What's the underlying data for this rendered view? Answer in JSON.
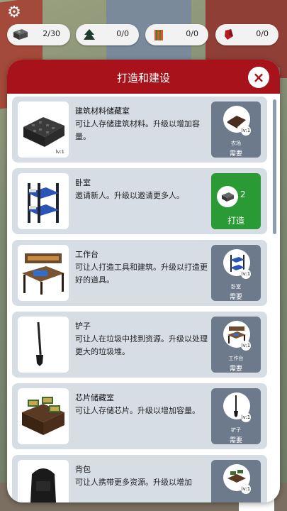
{
  "hud": {
    "resources": [
      {
        "icon": "brick-icon",
        "value": "2/30"
      },
      {
        "icon": "chip-icon",
        "value": "0/0"
      },
      {
        "icon": "book-icon",
        "value": "0/0"
      },
      {
        "icon": "crystal-icon",
        "value": "0/0"
      }
    ]
  },
  "panel": {
    "title": "打造和建设",
    "close_label": "×"
  },
  "items": [
    {
      "title": "建筑材料储藏室",
      "desc": "可让人存储建筑材料。升级以增加容量。",
      "level": "lv:1",
      "action": {
        "type": "requirement",
        "req_name": "农场",
        "req_level": "lv:1",
        "need_label": "需要"
      }
    },
    {
      "title": "卧室",
      "desc": "邀请新人。升级以邀请更多人。",
      "level": "",
      "action": {
        "type": "build",
        "cost": "2",
        "build_label": "打造"
      }
    },
    {
      "title": "工作台",
      "desc": "可让人打造工具和建筑。升级以打造更好的道具。",
      "level": "",
      "action": {
        "type": "requirement",
        "req_name": "卧室",
        "req_level": "lv:1",
        "need_label": "需要"
      }
    },
    {
      "title": "铲子",
      "desc": "可让人在垃圾中找到资源。升级以处理更大的垃圾堆。",
      "level": "",
      "action": {
        "type": "requirement",
        "req_name": "工作台",
        "req_level": "lv:1",
        "need_label": "需要"
      }
    },
    {
      "title": "芯片储藏室",
      "desc": "可让人存储芯片。升级以增加容量。",
      "level": "",
      "action": {
        "type": "requirement",
        "req_name": "铲子",
        "req_level": "lv:1",
        "need_label": "需要"
      }
    },
    {
      "title": "背包",
      "desc": "可让人携带更多资源。升级以增加",
      "level": "",
      "action": {
        "type": "requirement",
        "req_name": "",
        "req_level": "lv:1",
        "need_label": ""
      }
    }
  ],
  "colors": {
    "header": "#a8131b",
    "build": "#2a9a35",
    "requirement": "#6d7a8c",
    "card": "#d6dde5"
  }
}
